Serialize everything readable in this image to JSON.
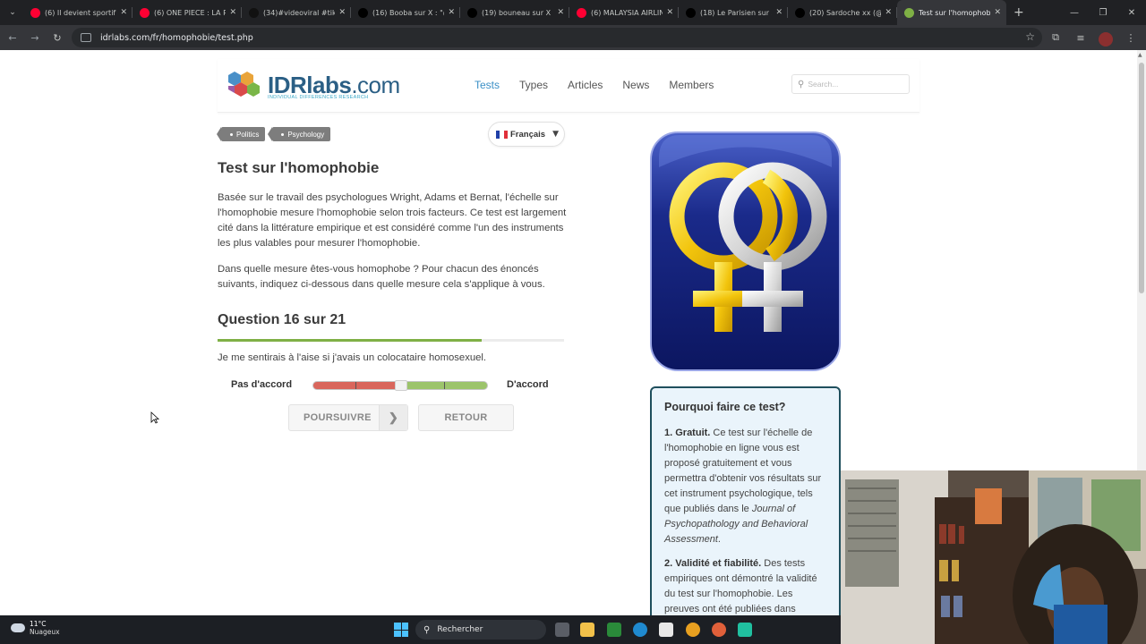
{
  "browser": {
    "tabs": [
      {
        "title": "(6) Il devient sportif d",
        "icon": "youtube-icon",
        "color": "#ff0033"
      },
      {
        "title": "(6) ONE PIECE : LA PR",
        "icon": "youtube-icon",
        "color": "#ff0033"
      },
      {
        "title": "(34)#videoviral #tiktok",
        "icon": "tiktok-icon",
        "color": "#111111"
      },
      {
        "title": "(16) Booba sur X : \"@",
        "icon": "x-icon",
        "color": "#000000"
      },
      {
        "title": "(19) bouneau sur X :",
        "icon": "x-icon",
        "color": "#000000"
      },
      {
        "title": "(6) MALAYSIA AIRLIN",
        "icon": "youtube-icon",
        "color": "#ff0033"
      },
      {
        "title": "(18) Le Parisien sur X",
        "icon": "x-icon",
        "color": "#000000"
      },
      {
        "title": "(20) Sardoche xx (@S",
        "icon": "x-icon",
        "color": "#000000"
      },
      {
        "title": "Test sur l'homophobi",
        "icon": "idrlabs-icon",
        "color": "#7fb045",
        "active": true
      }
    ],
    "url": "idrlabs.com/fr/homophobie/test.php"
  },
  "site": {
    "logo_main": "IDRlabs",
    "logo_tld": ".com",
    "logo_sub": "INDIVIDUAL DIFFERENCES RESEARCH",
    "nav": [
      {
        "label": "Tests",
        "active": true
      },
      {
        "label": "Types"
      },
      {
        "label": "Articles"
      },
      {
        "label": "News"
      },
      {
        "label": "Members"
      }
    ],
    "search_placeholder": "Search...",
    "accent": "#3a8fc6"
  },
  "tags": [
    "Politics",
    "Psychology"
  ],
  "language": "Français",
  "test": {
    "title": "Test sur l'homophobie",
    "intro": "Basée sur le travail des psychologues Wright, Adams et Bernat, l'échelle sur l'homophobie mesure l'homophobie selon trois facteurs. Ce test est largement cité dans la littérature empirique et est considéré comme l'un des instruments les plus valables pour mesurer l'homophobie.",
    "instructions": "Dans quelle mesure êtes-vous homophobe ? Pour chacun des énoncés suivants, indiquez ci-dessous dans quelle mesure cela s'applique à vous.",
    "question_label": "Question 16 sur 21",
    "progress": 0.762,
    "statement": "Je me sentirais à l'aise si j'avais un colocataire homosexuel.",
    "scale_left": "Pas d'accord",
    "scale_right": "D'accord",
    "slider_value": 0.5,
    "next_label": "POURSUIVRE",
    "back_label": "RETOUR",
    "progress_color": "#7fb045"
  },
  "sidebar": {
    "why_title": "Pourquoi faire ce test?",
    "point1_title": "1. Gratuit.",
    "point1_text_a": " Ce test sur l'échelle de l'homophobie en ligne vous est proposé gratuitement et vous permettra d'obtenir vos résultats sur cet instrument psychologique, tels que publiés dans le ",
    "point1_journal": "Journal of Psychopathology and Behavioral Assessment",
    "point1_text_b": ".",
    "point2_title": "2. Validité et fiabilité.",
    "point2_text": " Des tests empiriques ont démontré la validité du test sur l'homophobie. Les preuves ont été publiées dans"
  },
  "taskbar": {
    "temperature": "11°C",
    "weather": "Nuageux",
    "search": "Rechercher"
  }
}
